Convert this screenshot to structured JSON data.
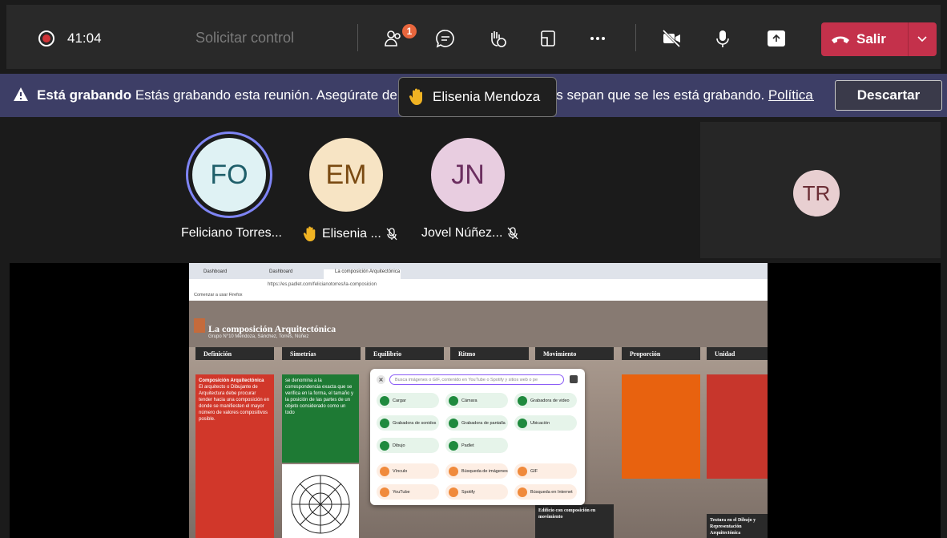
{
  "toolbar": {
    "timer": "41:04",
    "request_control": "Solicitar control",
    "participants_badge": "1",
    "leave_label": "Salir"
  },
  "banner": {
    "label_bold": "Está grabando",
    "message": " Estás grabando esta reunión. Asegúrate de que todos los participantes sepan que se les está grabando. ",
    "link": "Política de priva...",
    "dismiss": "Descartar"
  },
  "tooltip": {
    "name": "Elisenia Mendoza"
  },
  "participants": [
    {
      "initials": "FO",
      "name": "Feliciano Torres...",
      "color": "#dff2f4"
    },
    {
      "initials": "EM",
      "name": "Elisenia ...",
      "color": "#f7e4c4"
    },
    {
      "initials": "JN",
      "name": "Jovel Núñez...",
      "color": "#e8cde0"
    },
    {
      "initials": "TR",
      "color": "#e8cfd1"
    }
  ],
  "shared": {
    "tabs": [
      "Dashboard",
      "Dashboard",
      "La composición Arquitectónica"
    ],
    "url": "https://es.padlet.com/felicianotorres/la-composicion",
    "bookmark": "Comenzar a usar Firefox",
    "title": "La composición Arquitectónica",
    "subtitle": "Grupo N°10 Mendoza, Sánchez, Torres, Núñez",
    "columns": [
      "Definición",
      "Simetrías",
      "Equilibrio",
      "Ritmo",
      "Movimiento",
      "Proporción",
      "Unidad"
    ],
    "card_def_title": "Composición Arquitectónica",
    "card_def_text": "El arquitecto o Dibujante de Arquitectura debe procurar tender hacia una composición en donde se manifiesten el mayor número de valores compositivos posible.",
    "card_sim_text": "se denomina a la correspondencia exacta que se verifica en la forma, el tamaño y la posición de las partes de un objeto considerado como un todo",
    "card_mov_title": "Edificio con composición en movimiento",
    "card_uni_title": "Textura en el Dibujo y Representación Arquitectónica",
    "popup_search": "Busca imágenes o GIF, contenido en YouTube o Spotify y sitios web o pe",
    "popup_items": [
      "Cargar",
      "Cámara",
      "Grabadora de video",
      "Grabadora de sonidos",
      "Grabadora de pantalla",
      "Ubicación",
      "Dibujo",
      "Padlet",
      "",
      "Vínculo",
      "Búsqueda de imágenes",
      "GIF",
      "YouTube",
      "Spotify",
      "Búsqueda en Internet"
    ]
  }
}
